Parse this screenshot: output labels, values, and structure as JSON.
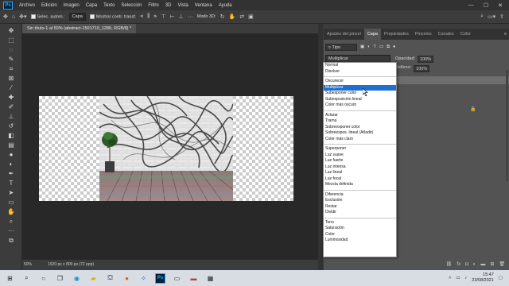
{
  "menubar": {
    "logo": "Ps",
    "items": [
      "Archivo",
      "Edición",
      "Imagen",
      "Capa",
      "Texto",
      "Selección",
      "Filtro",
      "3D",
      "Vista",
      "Ventana",
      "Ayuda"
    ],
    "win_min": "—",
    "win_max": "☐",
    "win_close": "✕"
  },
  "options": {
    "auto_select_label": "Selec. autom.:",
    "auto_select_value": "Capa",
    "show_transform": "Mostrar contr. transf.",
    "mode_3d": "Modo 3D:"
  },
  "document": {
    "tab_title": "Sin título-1 al 50% (abstract-1501710_1280, RGB/8) *",
    "zoom": "50%",
    "doc_info": "1920 px x 800 px (72 ppp)"
  },
  "panel": {
    "tabs": [
      "Ajustes del pincel",
      "Capa",
      "Propiedades",
      "Pinceles",
      "Canales",
      "Color"
    ],
    "active_tab": 1,
    "filter_label": "Tipo",
    "blend_mode": "Multiplicar",
    "opacity_label": "Opacidad:",
    "opacity_value": "100%",
    "fill_label": "Relleno:",
    "fill_value": "100%"
  },
  "blend_modes": [
    [
      "Normal",
      "Disolver"
    ],
    [
      "Oscurecer",
      "Multiplicar",
      "Subexponer color",
      "Subexposición lineal",
      "Color más oscuro"
    ],
    [
      "Aclarar",
      "Trama",
      "Sobreexponer color",
      "Sobreexpos. lineal (Añadir)",
      "Color más claro"
    ],
    [
      "Superponer",
      "Luz suave",
      "Luz fuerte",
      "Luz intensa",
      "Luz lineal",
      "Luz focal",
      "Mezcla definida"
    ],
    [
      "Diferencia",
      "Exclusión",
      "Restar",
      "Dividir"
    ],
    [
      "Tono",
      "Saturación",
      "Color",
      "Luminosidad"
    ]
  ],
  "highlighted_mode": "Multiplicar",
  "colors": {
    "foreground": "#2d2dd8",
    "background": "#e6004c",
    "highlight": "#1e6fcf"
  },
  "taskbar": {
    "search_icon": "search-icon",
    "time": "15:47",
    "date": "23/08/2021"
  }
}
